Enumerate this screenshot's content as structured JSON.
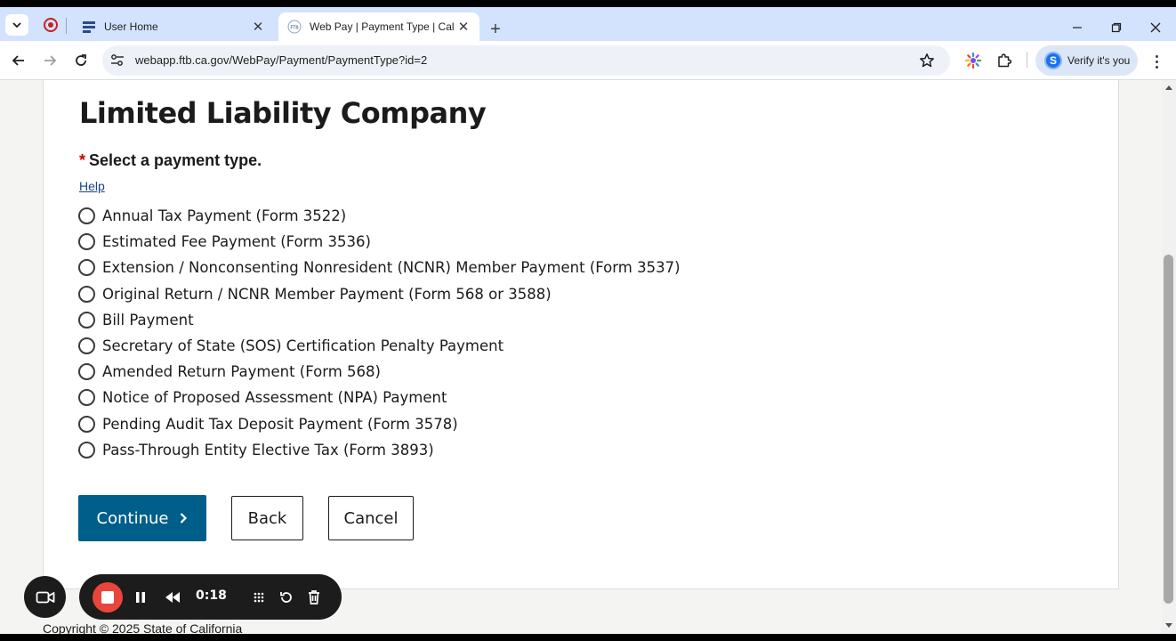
{
  "browser": {
    "tabs": [
      {
        "title": "User Home",
        "active": false
      },
      {
        "title": "Web Pay | Payment Type | Califo",
        "active": true
      }
    ],
    "url": "webapp.ftb.ca.gov/WebPay/Payment/PaymentType?id=2",
    "verify_label": "Verify it's you",
    "accent_color": "#d3e3fd"
  },
  "page": {
    "title": "Limited Liability Company",
    "required_mark": "*",
    "field_label": "Select a payment type.",
    "help_link": "Help",
    "payment_types": [
      "Annual Tax Payment (Form 3522)",
      "Estimated Fee Payment (Form 3536)",
      "Extension / Nonconsenting Nonresident (NCNR) Member Payment (Form 3537)",
      "Original Return / NCNR Member Payment (Form 568 or 3588)",
      "Bill Payment",
      "Secretary of State (SOS) Certification Penalty Payment",
      "Amended Return Payment (Form 568)",
      "Notice of Proposed Assessment (NPA) Payment",
      "Pending Audit Tax Deposit Payment (Form 3578)",
      "Pass-Through Entity Elective Tax (Form 3893)"
    ],
    "buttons": {
      "continue": "Continue",
      "back": "Back",
      "cancel": "Cancel"
    },
    "footer": "Copyright © 2025 State of California",
    "primary_color": "#005e8a"
  },
  "recorder": {
    "elapsed": "0:18"
  }
}
